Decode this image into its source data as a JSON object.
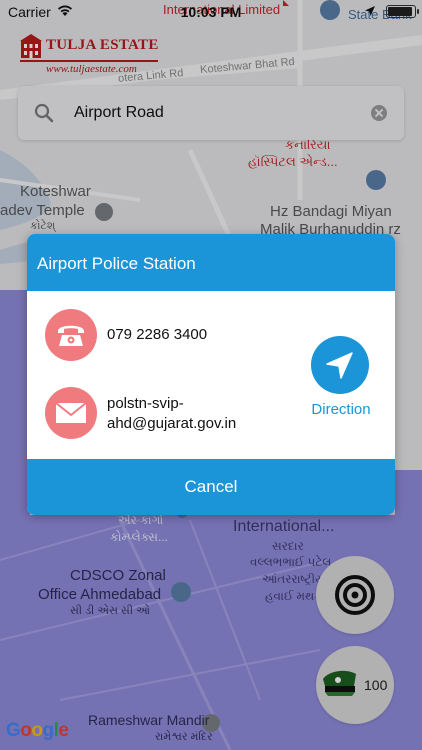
{
  "status_bar": {
    "carrier": "Carrier",
    "time": "10:03 PM"
  },
  "logo": {
    "title": "TULJA ESTATE",
    "url": "www.tuljaestate.com"
  },
  "search": {
    "value": "Airport Road",
    "placeholder": "Airport Road"
  },
  "map": {
    "labels": {
      "internat_limited": "International Limited",
      "state_bank": "State Bank",
      "motera_link": "otera Link Rd",
      "koteshwar_bhat": "Koteshwar Bhat Rd",
      "gujarati_hospital_1": "કનારિયા",
      "gujarati_hospital_2": "હૉસ્પિટલ એન્ડ...",
      "koteshwar_1": "Koteshwar",
      "koteshwar_2": "adev Temple",
      "koteshwar_3": "કોટેશ્",
      "hz_1": "Hz Bandagi Miyan",
      "hz_2": "Malik Burhanuddin rz",
      "cargo_1": "એર કાર્ગો",
      "cargo_2": "કોમ્પ્લેક્સ...",
      "international": "International...",
      "sardar_1": "સરદાર",
      "sardar_2": "વલ્લભભાઈ પટેલ",
      "sardar_3": "આંતરરાષ્ટ્રીય",
      "sardar_4": "હવાઈ મથક",
      "cdsco_1": "CDSCO Zonal",
      "cdsco_2": "Office Ahmedabad",
      "cdsco_3": "સી ડી એસ સી ઓ",
      "rameshwar_1": "Rameshwar Mandir",
      "rameshwar_2": "રામેશ્વર મંદિર"
    }
  },
  "dialog": {
    "title": "Airport Police Station",
    "phone": "079 2286 3400",
    "email": "polstn-svip-ahd@gujarat.gov.in",
    "direction_label": "Direction",
    "cancel_label": "Cancel"
  },
  "police_button": {
    "number": "100"
  },
  "google": {
    "letters": [
      "G",
      "o",
      "o",
      "g",
      "l",
      "e"
    ],
    "colors": [
      "#4285F4",
      "#EA4335",
      "#FBBC05",
      "#4285F4",
      "#34A853",
      "#EA4335"
    ]
  },
  "colors": {
    "accent": "#1b95d8",
    "contact_icon_bg": "#f07b7e",
    "brand_red": "#b71c1c",
    "airport_zone": "#8f8cdc"
  },
  "icons": {
    "wifi": "wifi-icon",
    "location": "location-arrow-icon",
    "battery": "battery-icon",
    "search": "search-icon",
    "clear": "clear-icon",
    "phone": "telephone-icon",
    "email": "envelope-icon",
    "direction": "navigation-arrow-icon",
    "target": "target-icon",
    "police": "police-cap-icon"
  }
}
